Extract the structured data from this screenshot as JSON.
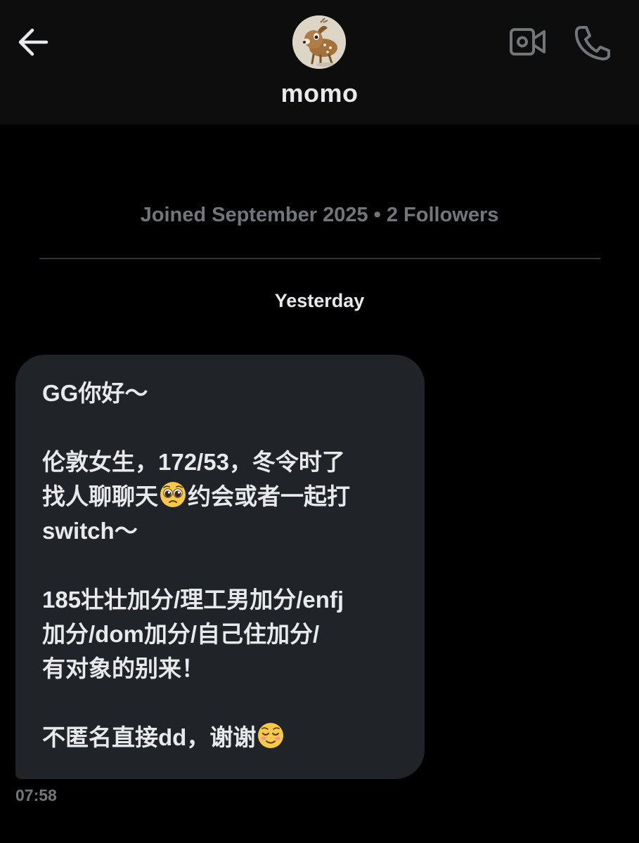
{
  "header": {
    "back_icon": "back-arrow-icon",
    "title": "momo",
    "avatar_icon": "fawn-avatar",
    "video_icon": "video-camera-icon",
    "call_icon": "phone-icon"
  },
  "profile": {
    "meta": "Joined September 2025 • 2 Followers"
  },
  "conversation": {
    "day_label": "Yesterday",
    "message": {
      "lines": [
        "GG你好～",
        "",
        "伦敦女生，172/53，冬令时了",
        "找人聊聊天",
        "约会或者一起打",
        "switch～",
        "",
        "185壮壮加分/理工男加分/enfj",
        "加分/dom加分/自己住加分/",
        "有对象的别来！",
        "",
        "不匿名直接dd，谢谢"
      ],
      "emojis": [
        "pleading-face-emoji",
        "smiling-face-emoji"
      ],
      "time": "07:58"
    }
  },
  "colors": {
    "background": "#000000",
    "header_background": "#0d0d0d",
    "bubble": "#202327",
    "primary_text": "#e7e9ea",
    "secondary_text": "#71767b",
    "divider": "#333639"
  }
}
